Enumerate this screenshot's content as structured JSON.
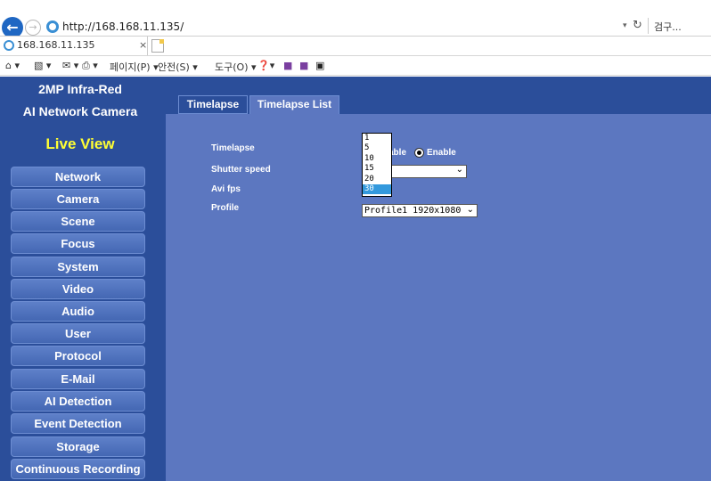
{
  "browser": {
    "url": "http://168.168.11.135/",
    "search_placeholder": "검구...",
    "tab_title": "168.168.11.135",
    "tab_close": "×",
    "back_glyph": "←",
    "refresh_glyph": "↻",
    "dropdown_glyph": "▾",
    "commands": {
      "home": "⌂ ▾",
      "rss": "▧ ▾",
      "read": "✉ ▾",
      "print": "⎙ ▾",
      "page": "페이지(P) ▾",
      "safety": "안전(S) ▾",
      "tools": "도구(O) ▾",
      "help": "❓▾"
    }
  },
  "sidebar": {
    "title_line1": "2MP Infra-Red",
    "title_line2": "AI Network Camera",
    "live_view": "Live View",
    "menu": [
      "Network",
      "Camera",
      "Scene",
      "Focus",
      "System",
      "Video",
      "Audio",
      "User",
      "Protocol",
      "E-Mail",
      "AI Detection",
      "Event Detection",
      "Storage",
      "Continuous Recording"
    ]
  },
  "main": {
    "tabs": [
      "Timelapse",
      "Timelapse List"
    ],
    "fields": {
      "timelapse_label": "Timelapse",
      "shutter_label": "Shutter speed",
      "fps_label": "Avi fps",
      "profile_label": "Profile"
    },
    "timelapse_options": {
      "disable_partial": "able",
      "enable": "Enable",
      "selected": "Enable"
    },
    "fps_options": [
      "1",
      "5",
      "10",
      "15",
      "20",
      "30"
    ],
    "fps_selected": "30",
    "profile_value": "Profile1 1920x1080",
    "select_arrow": "⌄"
  },
  "colors": {
    "sidebar_bg": "#2b4e9a",
    "panel_bg": "#5c77c0",
    "live_view": "#ffff33",
    "list_highlight": "#3399dd"
  }
}
